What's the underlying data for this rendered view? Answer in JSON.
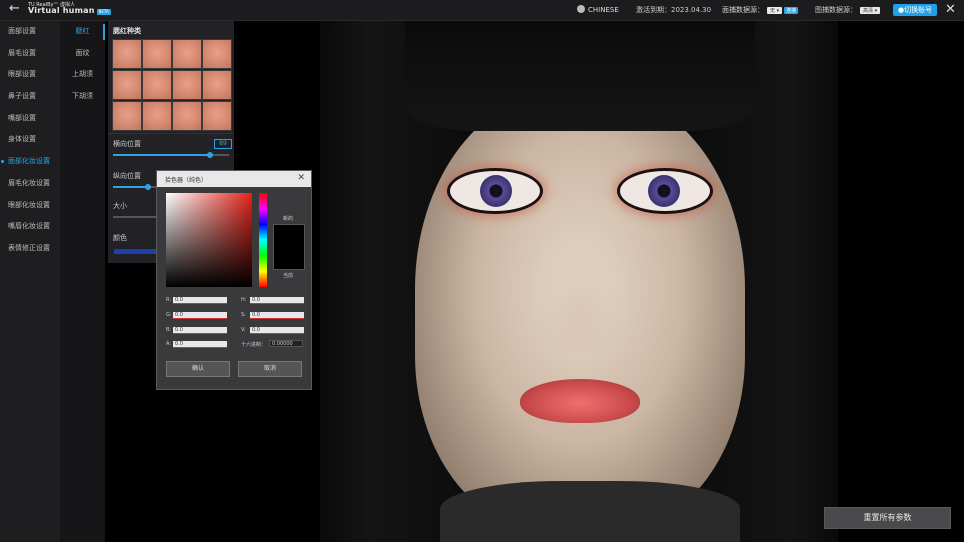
{
  "app": {
    "logo_small": "TU RealBy™ 虚拟人",
    "logo_big": "Virtual human",
    "logo_tag": "BETA"
  },
  "header": {
    "language": "CHINESE",
    "expiry_label": "激活到期：2023.04.30",
    "capture_source_label": "面捕数据源：",
    "capture_source_value": "无",
    "capture_source_badge": "连接",
    "image_source_label": "图捕数据源：",
    "image_source_value": "高清",
    "switch_account": "切换账号"
  },
  "sidebar": {
    "items": [
      {
        "label": "面部设置"
      },
      {
        "label": "眉毛设置"
      },
      {
        "label": "眼部设置"
      },
      {
        "label": "鼻子设置"
      },
      {
        "label": "嘴部设置"
      },
      {
        "label": "身体设置"
      },
      {
        "label": "面部化妆设置"
      },
      {
        "label": "眉毛化妆设置"
      },
      {
        "label": "眼部化妆设置"
      },
      {
        "label": "嘴唇化妆设置"
      },
      {
        "label": "表情修正设置"
      }
    ]
  },
  "subnav": {
    "items": [
      {
        "label": "腮红"
      },
      {
        "label": "面纹"
      },
      {
        "label": "上胡须"
      },
      {
        "label": "下胡须"
      }
    ]
  },
  "blush_panel": {
    "title": "腮红种类",
    "horizontal_label": "横向位置",
    "horizontal_value": "89",
    "vertical_label": "纵向位置",
    "size_label": "大小",
    "color_label": "颜色"
  },
  "color_picker": {
    "title": "拾色器（纯色）",
    "new_label": "新的",
    "current_label": "当前",
    "fields": {
      "R": "0.0",
      "G": "0.0",
      "B": "0.0",
      "A": "0.0",
      "H": "0.0",
      "S": "0.0",
      "V": "0.0"
    },
    "hex_label": "十六进制：",
    "hex_value": "0.00000",
    "ok": "确认",
    "cancel": "取消"
  },
  "reset_button": "重置所有参数",
  "colors": {
    "accent": "#2aa3e6",
    "bg_dark": "#1e1e20"
  }
}
